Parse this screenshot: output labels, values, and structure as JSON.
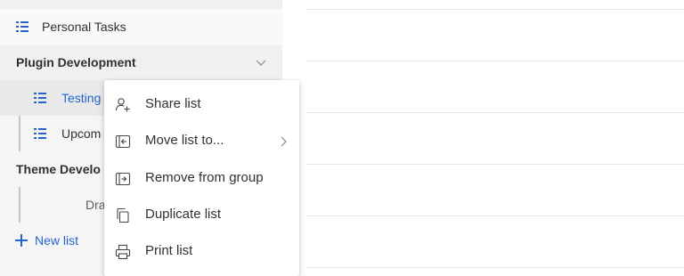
{
  "sidebar": {
    "personal_tasks": {
      "label": "Personal Tasks",
      "icon": "list-icon"
    },
    "groups": [
      {
        "label": "Plugin Development",
        "icon": "chevron-down-icon",
        "lists": [
          {
            "label": "Testing",
            "selected": true,
            "icon": "list-icon"
          },
          {
            "label": "Upcom",
            "icon": "list-icon"
          }
        ]
      },
      {
        "label": "Theme Develo",
        "lists": [
          {
            "label": "Dra"
          }
        ]
      }
    ],
    "new_list": {
      "label": "New list",
      "icon": "plus-icon"
    }
  },
  "context_menu": {
    "items": [
      {
        "label": "Share list",
        "icon": "share-person-icon"
      },
      {
        "label": "Move list to...",
        "icon": "move-list-icon",
        "has_submenu": true
      },
      {
        "label": "Remove from group",
        "icon": "remove-from-group-icon"
      },
      {
        "label": "Duplicate list",
        "icon": "duplicate-icon"
      },
      {
        "label": "Print list",
        "icon": "printer-icon"
      }
    ]
  },
  "colors": {
    "accent": "#2564cf",
    "sidebar_bg": "#f5f5f5",
    "selected_bg": "#eaeaea",
    "text": "#323130"
  }
}
